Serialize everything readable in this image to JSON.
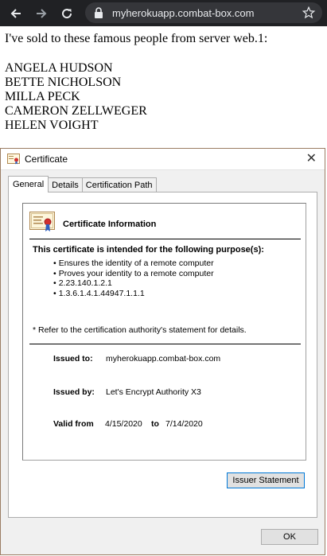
{
  "browser": {
    "url": "myherokuapp.combat-box.com",
    "icons": [
      "back-arrow-icon",
      "forward-arrow-icon",
      "reload-icon",
      "lock-icon",
      "star-icon"
    ]
  },
  "page": {
    "intro": "I've sold to these famous people from server web.1:",
    "names": [
      "ANGELA HUDSON",
      "BETTE NICHOLSON",
      "MILLA PECK",
      "CAMERON ZELLWEGER",
      "HELEN VOIGHT"
    ]
  },
  "dialog": {
    "title": "Certificate",
    "close_label": "✕",
    "tabs": [
      {
        "label": "General",
        "active": true
      },
      {
        "label": "Details",
        "active": false
      },
      {
        "label": "Certification Path",
        "active": false
      }
    ],
    "info_heading": "Certificate Information",
    "purpose_title": "This certificate is intended for the following purpose(s):",
    "purposes": [
      "Ensures the identity of a remote computer",
      "Proves your identity to a remote computer",
      "2.23.140.1.2.1",
      "1.3.6.1.4.1.44947.1.1.1"
    ],
    "refer_note": "* Refer to the certification authority's statement for details.",
    "issued_to_label": "Issued to:",
    "issued_to": "myherokuapp.combat-box.com",
    "issued_by_label": "Issued by:",
    "issued_by": "Let's Encrypt Authority X3",
    "valid_from_label": "Valid from",
    "valid_from": "4/15/2020",
    "valid_to_label": "to",
    "valid_to": "7/14/2020",
    "issuer_statement_button": "Issuer Statement",
    "ok_button": "OK",
    "colors": {
      "titlebar_border": "#9a7d63",
      "focus_blue": "#0078d7"
    }
  }
}
